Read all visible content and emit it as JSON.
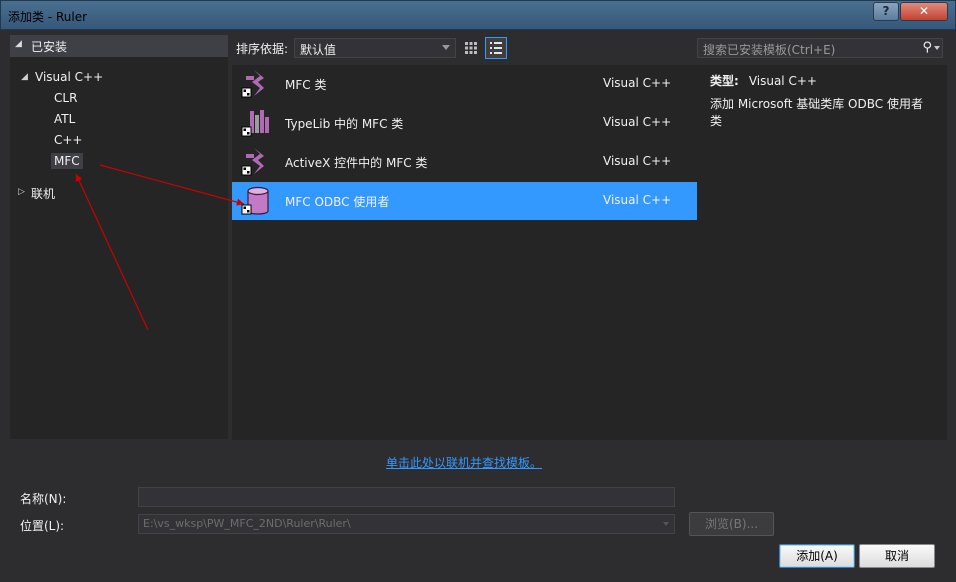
{
  "window": {
    "title": "添加类 - Ruler",
    "help_label": "?",
    "close_label": "✕"
  },
  "tree": {
    "header": "已安装",
    "root": "Visual C++",
    "children": [
      "CLR",
      "ATL",
      "C++",
      "MFC"
    ],
    "selected": "MFC",
    "online": "联机"
  },
  "toolbar": {
    "sort_label": "排序依据:",
    "sort_value": "默认值",
    "search_placeholder": "搜索已安装模板(Ctrl+E)"
  },
  "templates": [
    {
      "name": "MFC 类",
      "language": "Visual C++",
      "icon": "mfc-class-icon",
      "selected": false
    },
    {
      "name": "TypeLib 中的 MFC 类",
      "language": "Visual C++",
      "icon": "typelib-icon",
      "selected": false
    },
    {
      "name": "ActiveX 控件中的 MFC 类",
      "language": "Visual C++",
      "icon": "activex-icon",
      "selected": false
    },
    {
      "name": "MFC ODBC 使用者",
      "language": "Visual C++",
      "icon": "database-icon",
      "selected": true
    }
  ],
  "description": {
    "type_label": "类型:",
    "type_value": "Visual C++",
    "text": "添加 Microsoft 基础类库 ODBC 使用者类"
  },
  "online_link": "单击此处以联机并查找模板。",
  "form": {
    "name_label": "名称(N):",
    "name_value": "",
    "location_label": "位置(L):",
    "location_value": "E:\\vs_wksp\\PW_MFC_2ND\\Ruler\\Ruler\\",
    "browse_label": "浏览(B)...",
    "add_label": "添加(A)",
    "cancel_label": "取消"
  },
  "colors": {
    "selection": "#3399ff",
    "annotation_arrow": "#cc0000",
    "icon_purple": "#b06ab3"
  }
}
